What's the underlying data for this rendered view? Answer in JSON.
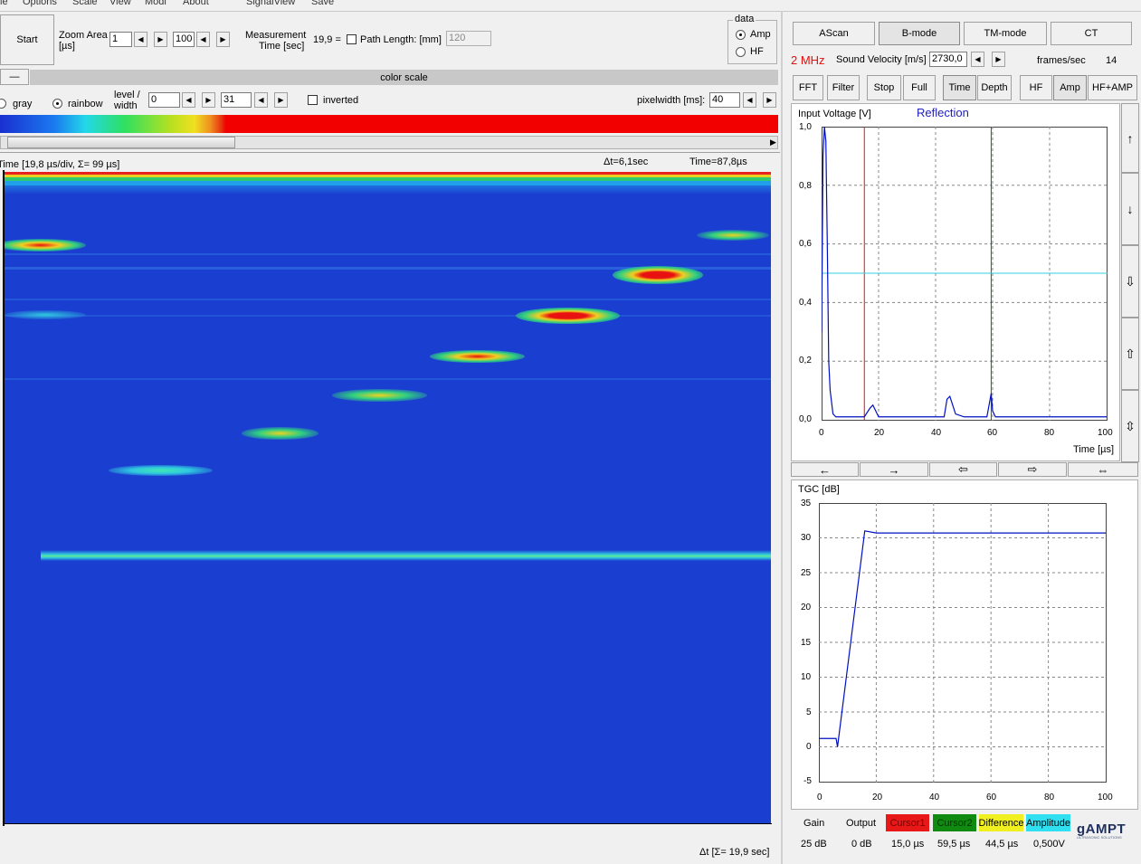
{
  "menu": {
    "items": [
      "le",
      "Options",
      "Scale",
      "View",
      "Modi",
      "About",
      "SignalView",
      "Save"
    ]
  },
  "toolbar": {
    "start_label": "Start",
    "zoom_label_1": "Zoom Area",
    "zoom_label_2": "[µs]",
    "zoom_from": "1",
    "zoom_to": "100",
    "measurement_label_1": "Measurement",
    "measurement_label_2": "Time [sec]",
    "measurement_value": "19,9 =",
    "path_length_label": "Path Length: [mm]",
    "path_length_value": "120",
    "data_group_label": "data",
    "data_amp": "Amp",
    "data_hf": "HF"
  },
  "colorscale": {
    "collapse_label": "—",
    "title": "color scale",
    "gray_label": "gray",
    "rainbow_label": "rainbow",
    "level_label_1": "level /",
    "level_label_2": "width",
    "level_value": "0",
    "width_value": "31",
    "inverted_label": "inverted",
    "pixelwidth_label": "pixelwidth [ms]:",
    "pixelwidth_value": "40"
  },
  "bmode": {
    "time_label": "Time   [19,8 µs/div, Σ= 99 µs]",
    "delta_t": "Δt=6,1sec",
    "time_value": "Time=87,8µs",
    "footer_label": "Δt   [Σ= 19,9 sec]"
  },
  "modes": {
    "tabs": [
      "AScan",
      "B-mode",
      "TM-mode",
      "CT"
    ],
    "frequency": "2 MHz",
    "sound_velocity_label": "Sound Velocity [m/s]",
    "sound_velocity_value": "2730,0",
    "frames_label": "frames/sec",
    "frames_value": "14",
    "buttons": [
      "FFT",
      "Filter",
      "Stop",
      "Full",
      "Time",
      "Depth",
      "HF",
      "Amp",
      "HF+AMP"
    ]
  },
  "ascan": {
    "ylabel": "Input Voltage [V]",
    "title": "Reflection",
    "xlabel": "Time [µs]",
    "yticks": [
      "1,0",
      "0,8",
      "0,6",
      "0,4",
      "0,2",
      "0,0"
    ],
    "xticks": [
      "0",
      "20",
      "40",
      "60",
      "80",
      "100"
    ],
    "nav_arrows": [
      "←",
      "→",
      "⇦",
      "⇨",
      "⇔"
    ],
    "side_arrows": [
      "↑",
      "↓",
      "⇩",
      "⇧",
      "⇳"
    ]
  },
  "tgc": {
    "ylabel": "TGC [dB]",
    "yticks": [
      "35",
      "30",
      "25",
      "20",
      "15",
      "10",
      "5",
      "0",
      "-5"
    ],
    "xticks": [
      "0",
      "20",
      "40",
      "60",
      "80",
      "100"
    ]
  },
  "status": {
    "gain_label": "Gain",
    "gain_value": "25 dB",
    "output_label": "Output",
    "output_value": "0 dB",
    "cursor1_label": "Cursor1",
    "cursor1_value": "15,0 µs",
    "cursor2_label": "Cursor2",
    "cursor2_value": "59,5 µs",
    "difference_label": "Difference",
    "difference_value": "44,5 µs",
    "amplitude_label": "Amplitude",
    "amplitude_value": "0,500V",
    "logo": "gAMPT",
    "logo_sub": "ULTRASONIC SOLUTIONS"
  },
  "chart_data": [
    {
      "type": "line",
      "title": "Reflection",
      "ylabel": "Input Voltage [V]",
      "xlabel": "Time [µs]",
      "xlim": [
        0,
        100
      ],
      "ylim": [
        0,
        1
      ],
      "series": [
        {
          "x": [
            0,
            0.5,
            1,
            1.5,
            2,
            2.5,
            3,
            4,
            5,
            10,
            15,
            17,
            18,
            19,
            20,
            30,
            43,
            44,
            45,
            46,
            47,
            50,
            58,
            59.5,
            60,
            61,
            70,
            80,
            90,
            100
          ],
          "y": [
            0.3,
            0.9,
            1.0,
            0.95,
            0.6,
            0.2,
            0.1,
            0.02,
            0.01,
            0.01,
            0.01,
            0.04,
            0.05,
            0.03,
            0.01,
            0.01,
            0.01,
            0.07,
            0.08,
            0.05,
            0.02,
            0.01,
            0.01,
            0.09,
            0.03,
            0.01,
            0.01,
            0.01,
            0.01,
            0.01
          ]
        }
      ],
      "cursors": {
        "cursor1": 15.0,
        "cursor2": 59.5,
        "amplitude": 0.5
      },
      "grid": true
    },
    {
      "type": "line",
      "ylabel": "TGC [dB]",
      "xlim": [
        0,
        100
      ],
      "ylim": [
        -5,
        35
      ],
      "series": [
        {
          "x": [
            0,
            6,
            6.5,
            16,
            20,
            100
          ],
          "y": [
            1.2,
            1.2,
            0,
            31,
            30.7,
            30.7
          ]
        }
      ],
      "grid": true
    }
  ]
}
